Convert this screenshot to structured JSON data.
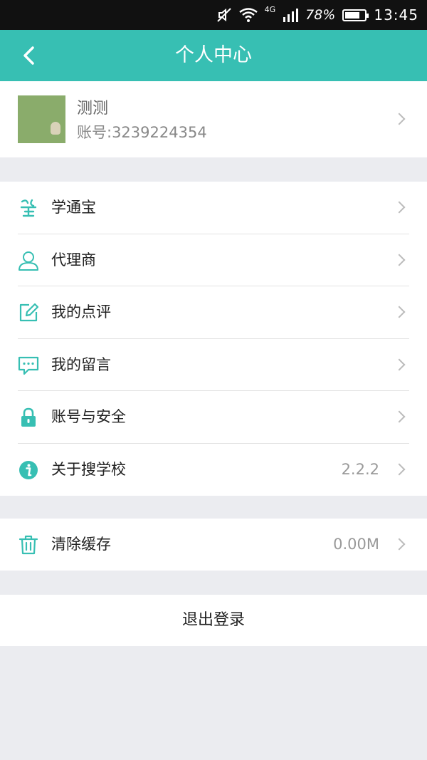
{
  "status_bar": {
    "battery_percent": "78%",
    "battery_level": 0.78,
    "network": "4G",
    "time": "13:45"
  },
  "header": {
    "title": "个人中心",
    "background": "#37bfb3"
  },
  "profile": {
    "name": "测测",
    "account": "账号:3239224354"
  },
  "menu": {
    "items": [
      {
        "label": "学通宝",
        "icon": "xuetongbao-icon"
      },
      {
        "label": "代理商",
        "icon": "user-icon"
      },
      {
        "label": "我的点评",
        "icon": "edit-icon"
      },
      {
        "label": "我的留言",
        "icon": "message-icon"
      },
      {
        "label": "账号与安全",
        "icon": "lock-icon"
      },
      {
        "label": "关于搜学校",
        "icon": "info-icon",
        "value": "2.2.2"
      }
    ]
  },
  "cache": {
    "label": "清除缓存",
    "icon": "trash-icon",
    "value": "0.00M"
  },
  "logout": {
    "label": "退出登录"
  },
  "colors": {
    "accent": "#37bfb3",
    "background": "#ebecf0"
  }
}
